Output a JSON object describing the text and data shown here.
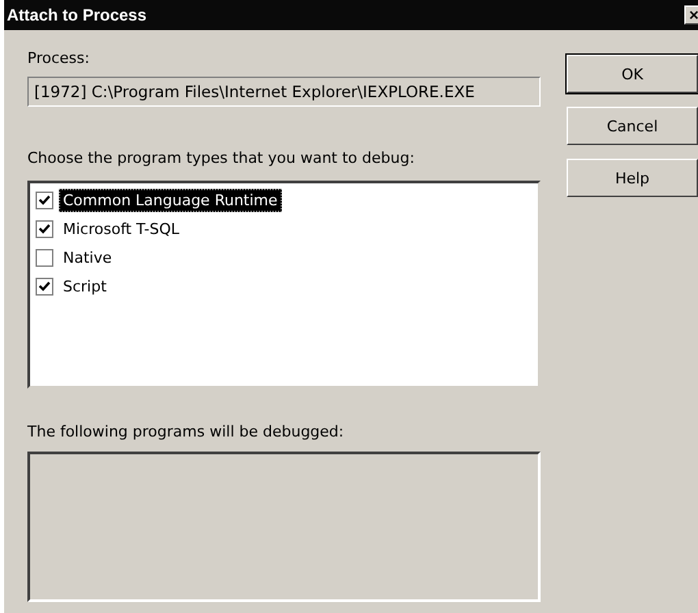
{
  "window": {
    "title": "Attach to Process",
    "close": "×"
  },
  "process": {
    "label": "Process:",
    "value": "[1972] C:\\Program Files\\Internet Explorer\\IEXPLORE.EXE"
  },
  "program_types": {
    "label": "Choose the program types that you want to debug:",
    "items": [
      {
        "label": "Common Language Runtime",
        "checked": true,
        "selected": true
      },
      {
        "label": "Microsoft T-SQL",
        "checked": true,
        "selected": false
      },
      {
        "label": "Native",
        "checked": false,
        "selected": false
      },
      {
        "label": "Script",
        "checked": true,
        "selected": false
      }
    ]
  },
  "debugged": {
    "label": "The following programs will be debugged:"
  },
  "buttons": [
    "OK",
    "Cancel",
    "Help"
  ]
}
